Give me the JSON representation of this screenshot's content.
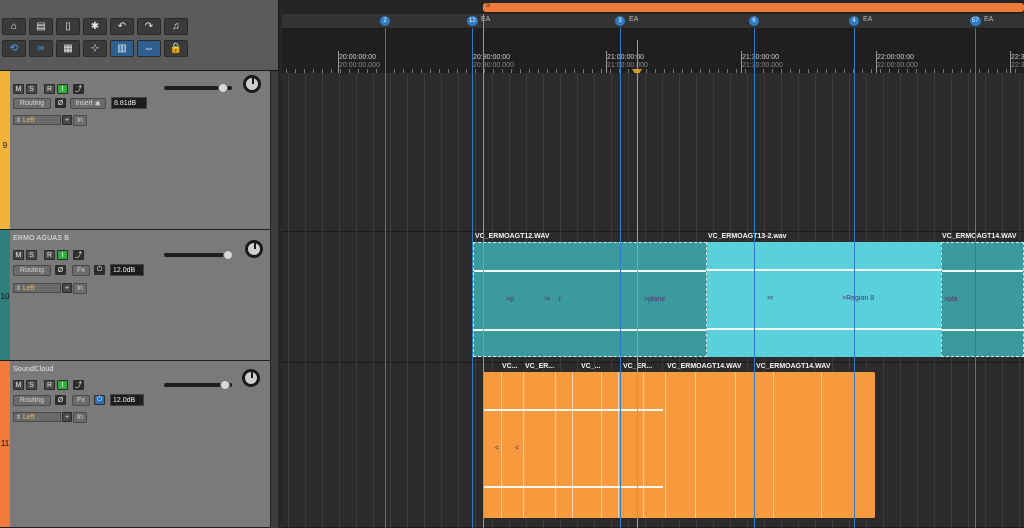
{
  "toolbar": {
    "row1": [
      {
        "name": "home-icon",
        "glyph": "⌂"
      },
      {
        "name": "folder-icon",
        "glyph": "▤"
      },
      {
        "name": "file-icon",
        "glyph": "▯"
      },
      {
        "name": "gear-icon",
        "glyph": "✱"
      },
      {
        "name": "undo-icon",
        "glyph": "↶"
      },
      {
        "name": "redo-icon",
        "glyph": "↷"
      },
      {
        "name": "metronome-icon",
        "glyph": "♫"
      }
    ],
    "row2": [
      {
        "name": "loop-icon",
        "glyph": "⟲"
      },
      {
        "name": "link-icon",
        "glyph": "∞"
      },
      {
        "name": "grid-icon",
        "glyph": "▦"
      },
      {
        "name": "snap-icon",
        "glyph": "⊹"
      },
      {
        "name": "split-icon",
        "glyph": "▥"
      },
      {
        "name": "trim-icon",
        "glyph": "⇔"
      },
      {
        "name": "lock-icon",
        "glyph": "🔒"
      }
    ]
  },
  "tracks": [
    {
      "number": "9",
      "name": "",
      "color": "#f2b33a",
      "m": "M",
      "s": "S",
      "r": "R",
      "i": "I",
      "routing": "Routing",
      "phase": "Ø",
      "fx": "Insert",
      "db": "8.81dB",
      "input": "Left",
      "in_label": "In"
    },
    {
      "number": "10",
      "name": "ERMO AGUAS B",
      "color": "#2f7f7f",
      "m": "M",
      "s": "S",
      "r": "R",
      "i": "I",
      "routing": "Routing",
      "phase": "Ø",
      "fx": "Fx",
      "db": "12.0dB",
      "input": "Left",
      "in_label": "In"
    },
    {
      "number": "11",
      "name": "SoundCloud",
      "color": "#f07a3a",
      "m": "M",
      "s": "S",
      "r": "R",
      "i": "I",
      "routing": "Routing",
      "phase": "Ø",
      "fx": "Fx",
      "db": "12.0dB",
      "input": "Left",
      "in_label": "In"
    }
  ],
  "timeline": {
    "range_label": "5",
    "markers": [
      {
        "label": "2",
        "ea": ""
      },
      {
        "label": "12",
        "ea": "EA"
      },
      {
        "label": "3",
        "ea": "EA"
      },
      {
        "label": "6",
        "ea": ""
      },
      {
        "label": "4",
        "ea": "EA"
      },
      {
        "label": "57",
        "ea": "EA"
      }
    ],
    "timecodes": [
      {
        "main": "20:00:00:00",
        "sub": "20:00:00.000"
      },
      {
        "main": "20:30:00:00",
        "sub": "20:30:00.000"
      },
      {
        "main": "21:00:00:00",
        "sub": "21:00:00.000"
      },
      {
        "main": "21:30:00:00",
        "sub": "21:30:00.000"
      },
      {
        "main": "22:00:00:00",
        "sub": "22:00:00.000"
      },
      {
        "main": "22:30:00:00",
        "sub": "22:30:00.000"
      }
    ]
  },
  "clips": {
    "track10": [
      {
        "title": "VC_ERMOAGT12.WAV",
        "label": ">plane"
      },
      {
        "title": "VC_ERMOAGT13-2.wav",
        "label": ">Region 8"
      },
      {
        "title": "VC_ERMOAGT14.WAV",
        "label": ">pla"
      }
    ],
    "track10_small": [
      ">p",
      ">r",
      "r",
      ">r"
    ],
    "track11": [
      {
        "title": "VC..."
      },
      {
        "title": "VC_ER..."
      },
      {
        "title": "VC_..."
      },
      {
        "title": "VC_ER..."
      },
      {
        "title": "VC_ERMOAGT14.WAV"
      },
      {
        "title": "VC_ERMOAGT14.WAV"
      }
    ],
    "track11_small": [
      "<",
      "<"
    ]
  },
  "colors": {
    "teal": "#3a9a9e",
    "cyan": "#5ad0da",
    "orange": "#f79a3e",
    "marker_blue": "#2d7cc4",
    "loop_gold": "#d4a72c"
  }
}
